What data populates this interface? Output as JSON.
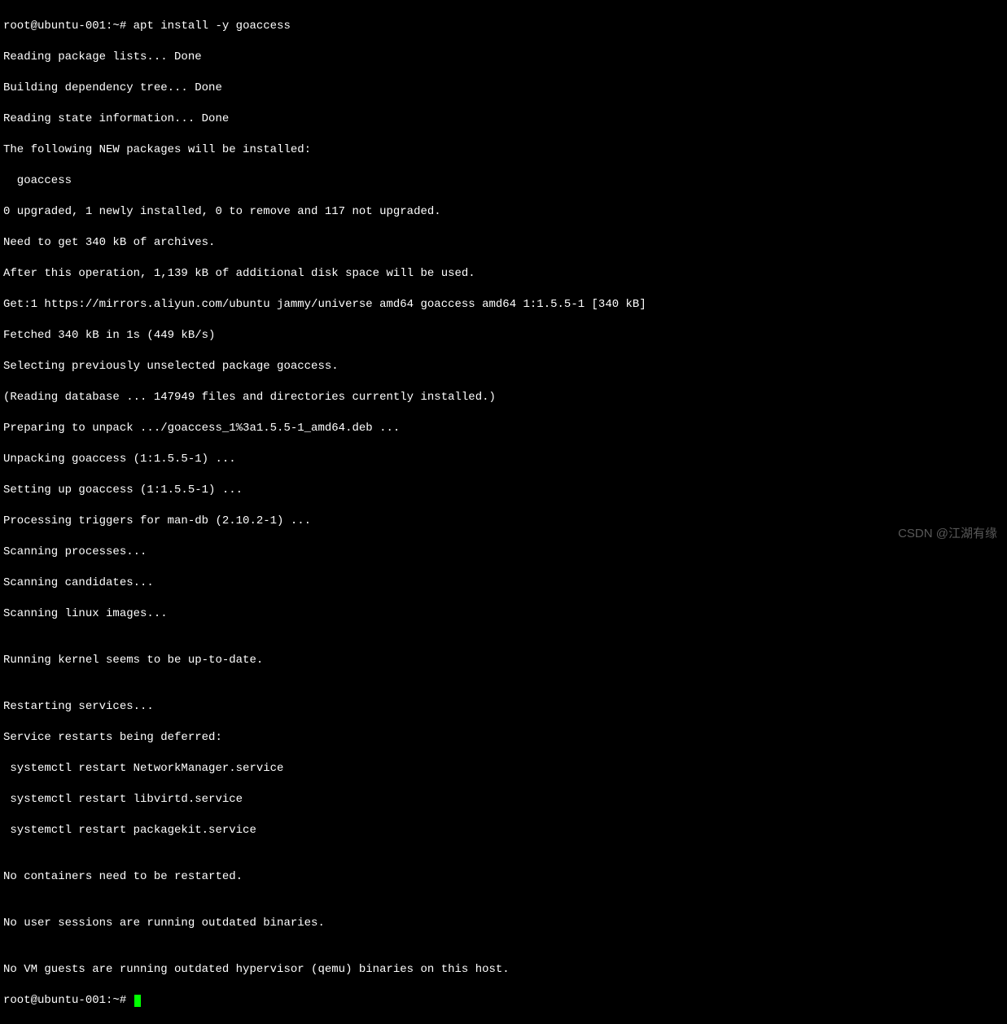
{
  "prompt1": {
    "user_host": "root@ubuntu-001",
    "path": ":~#",
    "command": "apt install -y goaccess"
  },
  "output": [
    "Reading package lists... Done",
    "Building dependency tree... Done",
    "Reading state information... Done",
    "The following NEW packages will be installed:",
    "  goaccess",
    "0 upgraded, 1 newly installed, 0 to remove and 117 not upgraded.",
    "Need to get 340 kB of archives.",
    "After this operation, 1,139 kB of additional disk space will be used.",
    "Get:1 https://mirrors.aliyun.com/ubuntu jammy/universe amd64 goaccess amd64 1:1.5.5-1 [340 kB]",
    "Fetched 340 kB in 1s (449 kB/s)",
    "Selecting previously unselected package goaccess.",
    "(Reading database ... 147949 files and directories currently installed.)",
    "Preparing to unpack .../goaccess_1%3a1.5.5-1_amd64.deb ...",
    "Unpacking goaccess (1:1.5.5-1) ...",
    "Setting up goaccess (1:1.5.5-1) ...",
    "Processing triggers for man-db (2.10.2-1) ...",
    "Scanning processes...",
    "Scanning candidates...",
    "Scanning linux images...",
    "",
    "Running kernel seems to be up-to-date.",
    "",
    "Restarting services...",
    "Service restarts being deferred:",
    " systemctl restart NetworkManager.service",
    " systemctl restart libvirtd.service",
    " systemctl restart packagekit.service",
    "",
    "No containers need to be restarted.",
    "",
    "No user sessions are running outdated binaries.",
    "",
    "No VM guests are running outdated hypervisor (qemu) binaries on this host."
  ],
  "prompt2": {
    "user_host": "root@ubuntu-001",
    "path": ":~#"
  },
  "watermark": "CSDN @江湖有缘"
}
